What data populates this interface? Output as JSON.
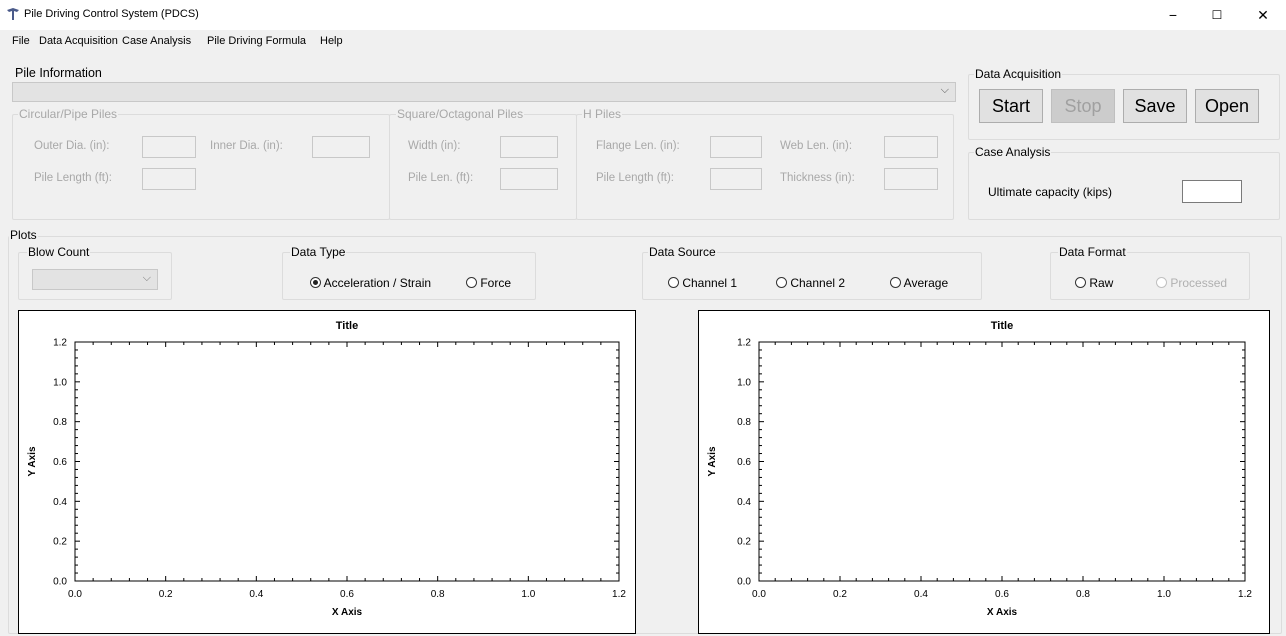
{
  "window": {
    "title": "Pile Driving Control System (PDCS)",
    "minimize": "−",
    "maximize": "☐",
    "close": "✕"
  },
  "menu": [
    "File",
    "Data Acquisition",
    "Case Analysis",
    "Pile Driving Formula",
    "Help"
  ],
  "pile_info": {
    "label": "Pile Information",
    "dropdown_value": "",
    "circular": {
      "label": "Circular/Pipe Piles",
      "outer_dia": "Outer Dia. (in):",
      "inner_dia": "Inner Dia. (in):",
      "pile_length": "Pile Length (ft):"
    },
    "square": {
      "label": "Square/Octagonal Piles",
      "width": "Width (in):",
      "pile_len": "Pile Len. (ft):"
    },
    "h": {
      "label": "H Piles",
      "flange_len": "Flange Len. (in):",
      "web_len": "Web Len. (in):",
      "pile_length": "Pile Length (ft):",
      "thickness": "Thickness (in):"
    }
  },
  "data_acq": {
    "label": "Data Acquisition",
    "start": "Start",
    "stop": "Stop",
    "save": "Save",
    "open": "Open"
  },
  "case": {
    "label": "Case Analysis",
    "ultimate": "Ultimate capacity (kips)",
    "ultimate_value": ""
  },
  "plots": {
    "label": "Plots",
    "blow_count": {
      "label": "Blow Count",
      "value": ""
    },
    "data_type": {
      "label": "Data Type",
      "opt1": "Acceleration / Strain",
      "opt2": "Force",
      "selected": "Acceleration / Strain"
    },
    "data_source": {
      "label": "Data Source",
      "opt1": "Channel 1",
      "opt2": "Channel 2",
      "opt3": "Average"
    },
    "data_format": {
      "label": "Data Format",
      "opt1": "Raw",
      "opt2": "Processed"
    }
  },
  "chart_data": [
    {
      "type": "line",
      "title": "Title",
      "xlabel": "X Axis",
      "ylabel": "Y Axis",
      "xlim": [
        0,
        1.2
      ],
      "ylim": [
        0,
        1.2
      ],
      "xticks": [
        "0.0",
        "0.2",
        "0.4",
        "0.6",
        "0.8",
        "1.0",
        "1.2"
      ],
      "yticks": [
        "0.0",
        "0.2",
        "0.4",
        "0.6",
        "0.8",
        "1.0",
        "1.2"
      ],
      "series": []
    },
    {
      "type": "line",
      "title": "Title",
      "xlabel": "X Axis",
      "ylabel": "Y Axis",
      "xlim": [
        0,
        1.2
      ],
      "ylim": [
        0,
        1.2
      ],
      "xticks": [
        "0.0",
        "0.2",
        "0.4",
        "0.6",
        "0.8",
        "1.0",
        "1.2"
      ],
      "yticks": [
        "0.0",
        "0.2",
        "0.4",
        "0.6",
        "0.8",
        "1.0",
        "1.2"
      ],
      "series": []
    }
  ]
}
